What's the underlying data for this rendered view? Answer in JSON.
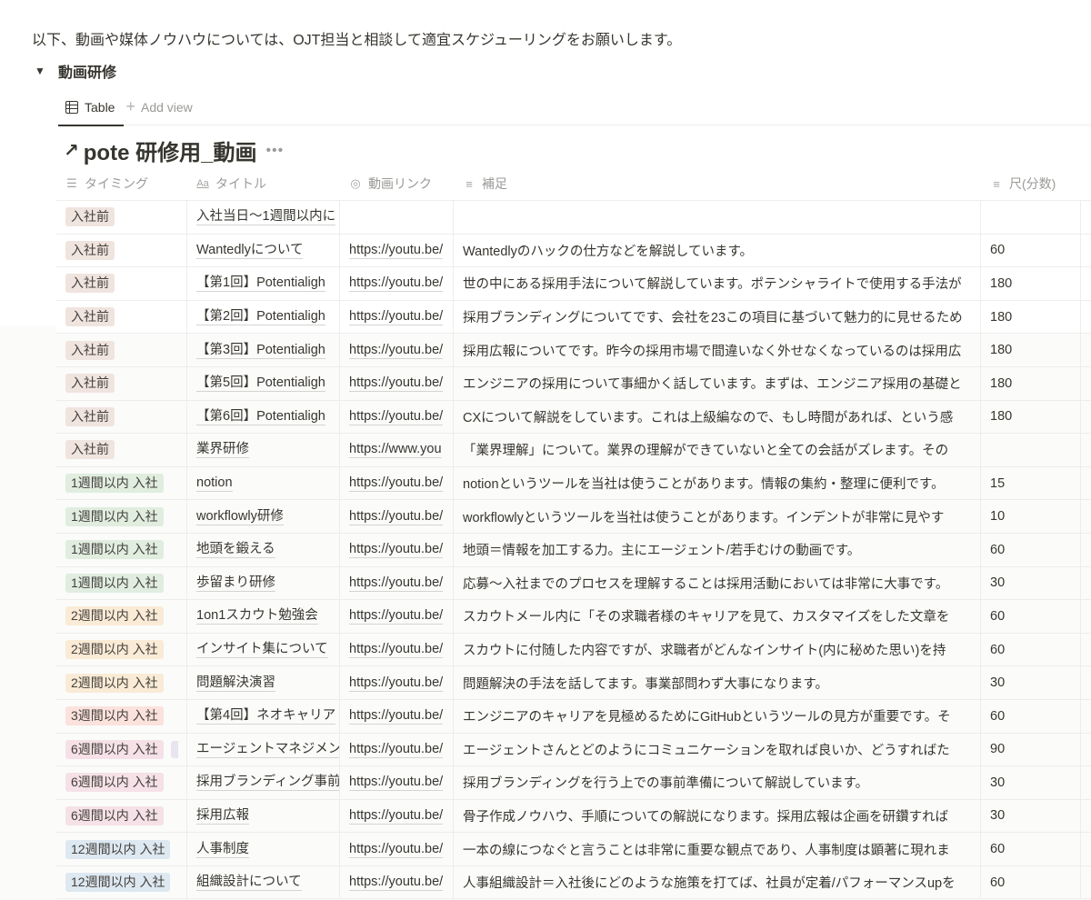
{
  "intro_text": "以下、動画や媒体ノウハウについては、OJT担当と相談して適宜スケジューリングをお願いします。",
  "toggle": {
    "icon": "triangle-down",
    "title": "動画研修"
  },
  "views": {
    "active_tab": {
      "icon": "table-icon",
      "label": "Table"
    },
    "add_view": {
      "icon": "plus-icon",
      "label": "Add view"
    }
  },
  "database": {
    "link_icon": "↗",
    "title": "pote 研修用_動画",
    "more_icon": "•••"
  },
  "columns": [
    {
      "icon": "list-icon",
      "glyph": "☰",
      "label": "タイミング"
    },
    {
      "icon": "text-aa-icon",
      "glyph": "Aa",
      "label": "タイトル"
    },
    {
      "icon": "url-spiral-icon",
      "glyph": "◎",
      "label": "動画リンク"
    },
    {
      "icon": "text-lines-icon",
      "glyph": "≡",
      "label": "補足"
    },
    {
      "icon": "text-lines-icon",
      "glyph": "≡",
      "label": "尺(分数)"
    }
  ],
  "tag_colors": {
    "入社前": "#f0e4df",
    "1週間以内 入社": "#e0eddf",
    "2週間以内 入社": "#faebd6",
    "3週間以内 入社": "#fbe2dc",
    "6週間以内 入社": "#f5e1e7",
    "12週間以内 入社": "#dde8f1"
  },
  "rows": [
    {
      "timing": "入社前",
      "title": "入社当日〜1週間以内に",
      "title_bold": false,
      "link": "",
      "note": "",
      "minutes": ""
    },
    {
      "timing": "入社前",
      "title": "Wantedlyについて",
      "title_bold": true,
      "link": "https://youtu.be/",
      "note": "Wantedlyのハックの仕方などを解説しています。",
      "minutes": "60"
    },
    {
      "timing": "入社前",
      "title": "【第1回】Potentialigh",
      "title_bold": true,
      "link": "https://youtu.be/",
      "note": "世の中にある採用手法について解説しています。ポテンシャライトで使用する手法が",
      "minutes": "180"
    },
    {
      "timing": "入社前",
      "title": "【第2回】Potentialigh",
      "title_bold": true,
      "link": "https://youtu.be/",
      "note": "採用ブランディングについてです、会社を23この項目に基づいて魅力的に見せるため",
      "minutes": "180"
    },
    {
      "timing": "入社前",
      "title": "【第3回】Potentialigh",
      "title_bold": true,
      "link": "https://youtu.be/",
      "note": "採用広報についてです。昨今の採用市場で間違いなく外せなくなっているのは採用広",
      "minutes": "180"
    },
    {
      "timing": "入社前",
      "title": "【第5回】Potentialigh",
      "title_bold": true,
      "link": "https://youtu.be/",
      "note": "エンジニアの採用について事細かく話しています。まずは、エンジニア採用の基礎と",
      "minutes": "180"
    },
    {
      "timing": "入社前",
      "title": "【第6回】Potentialigh",
      "title_bold": true,
      "link": "https://youtu.be/",
      "note": "CXについて解説をしています。これは上級編なので、もし時間があれば、という感",
      "minutes": "180"
    },
    {
      "timing": "入社前",
      "title": "業界研修",
      "title_bold": false,
      "link": "https://www.you",
      "note": "「業界理解」について。業界の理解ができていないと全ての会話がズレます。その",
      "minutes": ""
    },
    {
      "timing": "1週間以内 入社",
      "title": "notion",
      "title_bold": true,
      "link": "https://youtu.be/",
      "note": "notionというツールを当社は使うことがあります。情報の集約・整理に便利です。",
      "minutes": "15"
    },
    {
      "timing": "1週間以内 入社",
      "title": "workflowly研修",
      "title_bold": true,
      "link": "https://youtu.be/",
      "note": "workflowlyというツールを当社は使うことがあります。インデントが非常に見やす",
      "minutes": "10"
    },
    {
      "timing": "1週間以内 入社",
      "title": "地頭を鍛える",
      "title_bold": false,
      "link": "https://youtu.be/",
      "note": "地頭＝情報を加工する力。主にエージェント/若手むけの動画です。",
      "minutes": "60"
    },
    {
      "timing": "1週間以内 入社",
      "title": "歩留まり研修",
      "title_bold": false,
      "link": "https://youtu.be/",
      "note": "応募〜入社までのプロセスを理解することは採用活動においては非常に大事です。",
      "minutes": "30"
    },
    {
      "timing": "2週間以内 入社",
      "title": "1on1スカウト勉強会",
      "title_bold": false,
      "link": "https://youtu.be/",
      "note": "スカウトメール内に「その求職者様のキャリアを見て、カスタマイズをした文章を",
      "minutes": "60"
    },
    {
      "timing": "2週間以内 入社",
      "title": "インサイト集について",
      "title_bold": false,
      "link": "https://youtu.be/",
      "note": "スカウトに付随した内容ですが、求職者がどんなインサイト(内に秘めた思い)を持",
      "minutes": "60"
    },
    {
      "timing": "2週間以内 入社",
      "title": "問題解決演習",
      "title_bold": false,
      "link": "https://youtu.be/",
      "note": "問題解決の手法を話してます。事業部問わず大事になります。",
      "minutes": "30"
    },
    {
      "timing": "3週間以内 入社",
      "title": "【第4回】ネオキャリア",
      "title_bold": false,
      "link": "https://youtu.be/",
      "note": "エンジニアのキャリアを見極めるためにGitHubというツールの見方が重要です。そ",
      "minutes": "60"
    },
    {
      "timing": "6週間以内 入社",
      "title": "エージェントマネジメント",
      "title_bold": false,
      "link": "https://youtu.be/",
      "note": "エージェントさんとどのようにコミュニケーションを取れば良いか、どうすればた",
      "minutes": "90",
      "extra_tag": true
    },
    {
      "timing": "6週間以内 入社",
      "title": "採用ブランディング事前",
      "title_bold": false,
      "link": "https://youtu.be/",
      "note": "採用ブランディングを行う上での事前準備について解説しています。",
      "minutes": "30"
    },
    {
      "timing": "6週間以内 入社",
      "title": "採用広報",
      "title_bold": false,
      "link": "https://youtu.be/",
      "note": "骨子作成ノウハウ、手順についての解説になります。採用広報は企画を研鑽すれば",
      "minutes": "30"
    },
    {
      "timing": "12週間以内 入社",
      "title": "人事制度",
      "title_bold": false,
      "link": "https://youtu.be/",
      "note": "一本の線につなぐと言うことは非常に重要な観点であり、人事制度は顕著に現れま",
      "minutes": "60"
    },
    {
      "timing": "12週間以内 入社",
      "title": "組織設計について",
      "title_bold": false,
      "link": "https://youtu.be/",
      "note": "人事組織設計＝入社後にどのような施策を打てば、社員が定着/パフォーマンスupを",
      "minutes": "60"
    }
  ]
}
